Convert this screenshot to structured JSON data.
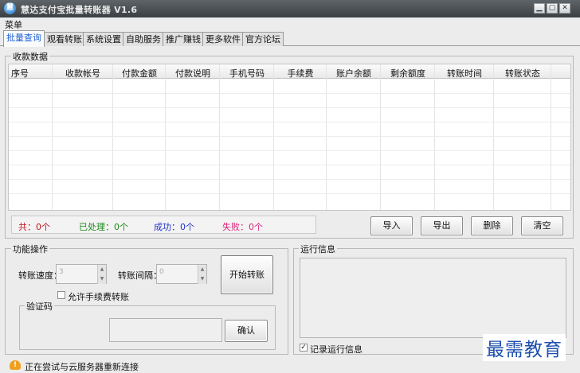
{
  "window": {
    "title": "慧达支付宝批量转账器 V1.6",
    "icon": "app-logo-icon"
  },
  "window_controls": {
    "minimize": "▁",
    "maximize": "▢",
    "close": "✕"
  },
  "menubar": {
    "menu": "菜单"
  },
  "tabs": [
    "批量查询",
    "观看转账",
    "系统设置",
    "自助服务",
    "推广赚钱",
    "更多软件",
    "官方论坛"
  ],
  "receive": {
    "legend": "收款数据",
    "columns": [
      "序号",
      "收款帐号",
      "付款金额",
      "付款说明",
      "手机号码",
      "手续费",
      "账户余额",
      "剩余额度",
      "转账时间",
      "转账状态"
    ]
  },
  "stats": {
    "total": "共：0个",
    "processed": "已处理：0个",
    "success": "成功：0个",
    "fail": "失败：0个",
    "colors": {
      "total": "#c0141e",
      "processed": "#1a8a1a",
      "success": "#2233cc",
      "fail": "#e0207a"
    }
  },
  "actions": {
    "import": "导入",
    "export": "导出",
    "delete": "删除",
    "clear": "清空"
  },
  "ops": {
    "legend": "功能操作",
    "speed_label": "转账速度：",
    "speed_value": "3",
    "interval_label": "转账间隔：",
    "interval_value": "0",
    "start": "开始转账",
    "allow_fee": "允许手续费转账",
    "captcha_legend": "验证码",
    "confirm": "确认"
  },
  "runlog": {
    "legend": "运行信息",
    "record": "记录运行信息",
    "record_checked": true
  },
  "footer": {
    "status": "正在尝试与云服务器重新连接",
    "icon": "cloud-warning-icon"
  },
  "watermark": "最需教育"
}
